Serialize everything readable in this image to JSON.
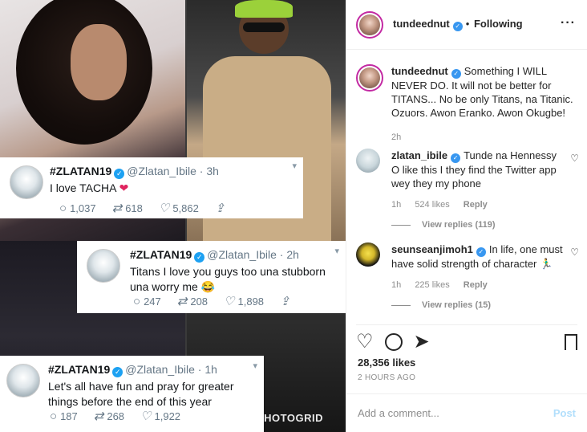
{
  "tweets": [
    {
      "name": "#ZLATAN19",
      "handle": "@Zlatan_Ibile · 3h",
      "text": "I love TACHA",
      "replies": "1,037",
      "retweets": "618",
      "likes": "5,862"
    },
    {
      "name": "#ZLATAN19",
      "handle": "@Zlatan_Ibile · 2h",
      "text": "Titans I love you guys too una stubborn una worry me 😂",
      "replies": "247",
      "retweets": "208",
      "likes": "1,898"
    },
    {
      "name": "#ZLATAN19",
      "handle": "@Zlatan_Ibile · 1h",
      "text": "Let's all have fun and pray for greater things before the end of this year",
      "replies": "187",
      "retweets": "268",
      "likes": "1,922"
    }
  ],
  "watermark": "PHOTOGRID",
  "post": {
    "author": "tundeednut",
    "follow_status": "Following",
    "caption": "Something I WILL NEVER DO. It will not be better for TITANS... No be only Titans, na Titanic. Ozuors. Awon Eranko. Awon Okugbe!",
    "caption_time": "2h",
    "likes": "28,356 likes",
    "timestamp": "2 HOURS AGO",
    "add_comment_placeholder": "Add a comment...",
    "post_button": "Post"
  },
  "comments": [
    {
      "user": "zlatan_ibile",
      "text": "Tunde na Hennessy O like this I they find the Twitter app wey they my phone",
      "time": "1h",
      "likes": "524 likes",
      "reply": "Reply",
      "view_replies": "View replies (119)"
    },
    {
      "user": "seunseanjimoh1",
      "text": "In life, one must have solid strength of character 🏃‍♂️",
      "time": "1h",
      "likes": "225 likes",
      "reply": "Reply",
      "view_replies": "View replies (15)"
    }
  ],
  "icons": {
    "verified": "verified-check-icon",
    "more": "more-options-icon",
    "heart": "heart-icon",
    "comment": "comment-bubble-icon",
    "save": "bookmark-icon",
    "reply": "reply-icon",
    "retweet": "retweet-icon",
    "share": "share-icon"
  },
  "colors": {
    "instagram_blue": "#3897f0",
    "twitter_blue": "#1da1f2",
    "heart_red": "#e0245e"
  }
}
